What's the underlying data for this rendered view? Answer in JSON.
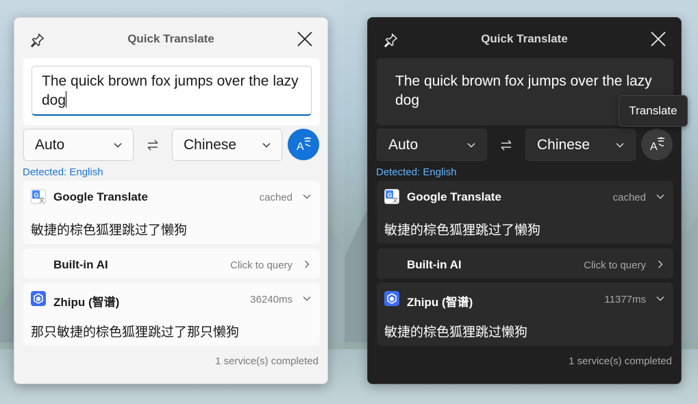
{
  "colors": {
    "accent_light": "#1473d8",
    "accent_dark_detected": "#60b4ff",
    "light_bg": "#f3f3f3",
    "dark_bg": "#202020"
  },
  "light": {
    "title": "Quick Translate",
    "input_text": "The quick brown fox jumps over the lazy dog",
    "source_lang": "Auto",
    "target_lang": "Chinese",
    "detected": "Detected: English",
    "services": [
      {
        "name": "Google Translate",
        "status": "cached",
        "result": "敏捷的棕色狐狸跳过了懒狗",
        "icon": "google-translate-icon"
      },
      {
        "name": "Built-in AI",
        "status": "Click to query",
        "result": "",
        "icon": ""
      },
      {
        "name": "Zhipu (智谱)",
        "status": "36240ms",
        "result": "那只敏捷的棕色狐狸跳过了那只懒狗",
        "icon": "zhipu-icon"
      }
    ],
    "footer": "1 service(s) completed"
  },
  "dark": {
    "title": "Quick Translate",
    "input_text": "The quick brown fox jumps over the lazy dog",
    "source_lang": "Auto",
    "target_lang": "Chinese",
    "detected": "Detected: English",
    "tooltip": "Translate",
    "services": [
      {
        "name": "Google Translate",
        "status": "cached",
        "result": "敏捷的棕色狐狸跳过了懒狗",
        "icon": "google-translate-icon"
      },
      {
        "name": "Built-in AI",
        "status": "Click to query",
        "result": "",
        "icon": ""
      },
      {
        "name": "Zhipu (智谱)",
        "status": "11377ms",
        "result": "敏捷的棕色狐狸跳过懒狗",
        "icon": "zhipu-icon"
      }
    ],
    "footer": "1 service(s) completed"
  }
}
